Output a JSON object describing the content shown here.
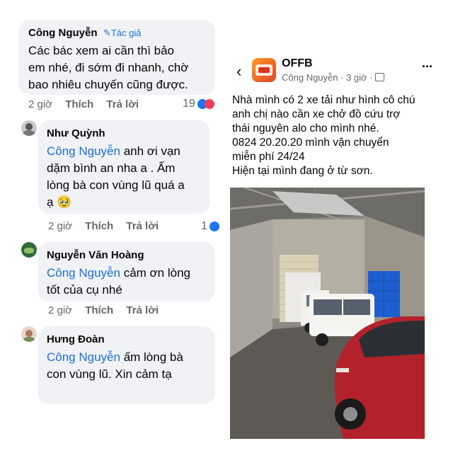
{
  "comments": [
    {
      "name": "Công Nguyễn",
      "badge": "Tác giả",
      "text_lines": [
        "Các bác xem ai cần thì bảo",
        "em nhé, đi sớm đi nhanh, chờ",
        "bao nhiêu chuyến cũng được."
      ],
      "time": "2 giờ",
      "like": "Thích",
      "reply": "Trả lời",
      "reactions": "19"
    },
    {
      "name": "Như Quỳnh",
      "mention": "Công Nguyễn",
      "text_lines": [
        " anh ơi vạn",
        "dặm bình an nha a . Ấm",
        "lòng bà con vùng lũ quá a",
        "ạ 🥹"
      ],
      "time": "2 giờ",
      "like": "Thích",
      "reply": "Trả lời",
      "reactions": "1"
    },
    {
      "name": "Nguyễn Văn Hoàng",
      "mention": "Công Nguyễn",
      "text_lines": [
        " cảm ơn lòng",
        "tốt của cụ nhé"
      ],
      "time": "2 giờ",
      "like": "Thích",
      "reply": "Trả lời"
    },
    {
      "name": "Hưng Đoàn",
      "mention": "Công Nguyễn",
      "text_lines": [
        " ấm lòng bà",
        "con vùng lũ. Xin cảm tạ"
      ]
    }
  ],
  "post": {
    "page_name": "OFFB",
    "author": "Công Nguyễn",
    "time": "3 giờ",
    "separator": "·",
    "more": "···",
    "text_lines": [
      "Nhà mình có 2 xe tải như hình cô chú",
      "anh chị nào cần xe chở đồ cứu trợ",
      "thái nguyên alo cho mình nhé.",
      "0824 20.20.20 mình vận chuyển",
      "miễn phí 24/24",
      "Hiện tại mình đang ở từ sơn."
    ]
  },
  "colors": {
    "mention": "#1d6fd8",
    "bubble": "#f0f2f5",
    "meta": "#65676b",
    "car_red": "#b3222a"
  },
  "icons": [
    "pencil-icon",
    "like-reaction-icon",
    "love-reaction-icon",
    "back-arrow-icon",
    "group-icon",
    "more-icon"
  ]
}
